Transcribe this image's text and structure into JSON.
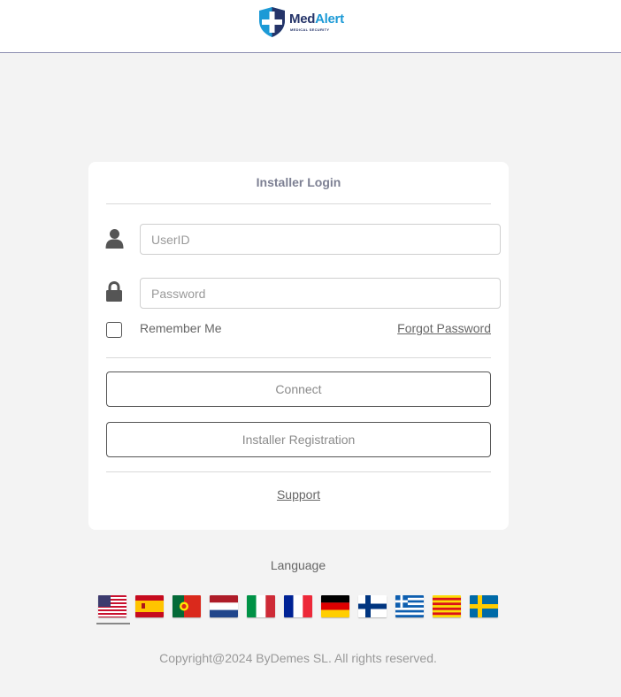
{
  "header": {
    "brand_part1": "Med",
    "brand_part2": "Alert",
    "tagline": "MEDICAL SECURITY",
    "logo_icon": "shield-cross-icon",
    "colors": {
      "navy": "#253469",
      "blue": "#1c9ad6"
    }
  },
  "login": {
    "title": "Installer Login",
    "userid": {
      "placeholder": "UserID",
      "value": ""
    },
    "password": {
      "placeholder": "Password",
      "value": ""
    },
    "remember_label": "Remember Me",
    "remember_checked": false,
    "forgot_label": "Forgot Password",
    "connect_label": "Connect",
    "register_label": "Installer Registration",
    "support_label": "Support"
  },
  "language": {
    "label": "Language",
    "selected": "en-us",
    "flags": [
      {
        "code": "en-us",
        "name": "united-states-flag-icon"
      },
      {
        "code": "es",
        "name": "spain-flag-icon"
      },
      {
        "code": "pt",
        "name": "portugal-flag-icon"
      },
      {
        "code": "nl",
        "name": "netherlands-flag-icon"
      },
      {
        "code": "it",
        "name": "italy-flag-icon"
      },
      {
        "code": "fr",
        "name": "france-flag-icon"
      },
      {
        "code": "de",
        "name": "germany-flag-icon"
      },
      {
        "code": "fi",
        "name": "finland-flag-icon"
      },
      {
        "code": "el",
        "name": "greece-flag-icon"
      },
      {
        "code": "ca",
        "name": "catalonia-flag-icon"
      },
      {
        "code": "sv",
        "name": "sweden-flag-icon"
      }
    ]
  },
  "footer": {
    "copyright": "Copyright@2024 ByDemes SL. All rights reserved."
  }
}
